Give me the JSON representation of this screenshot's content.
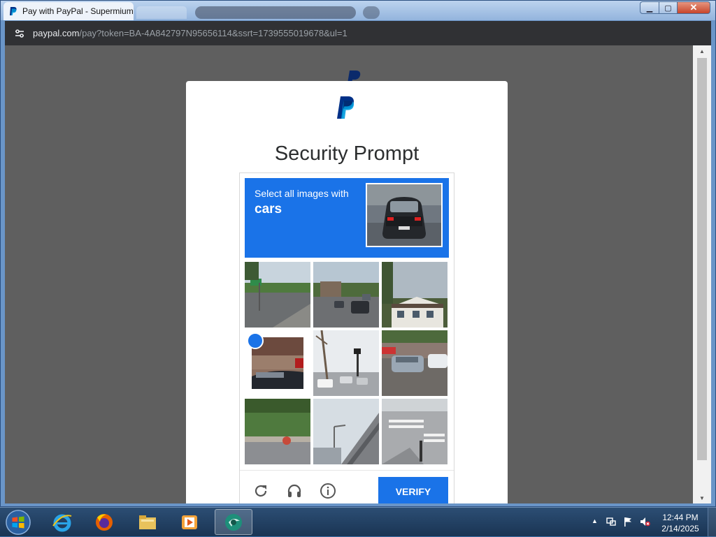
{
  "window": {
    "tab_title": "Pay with PayPal - Supermium",
    "min_glyph": "▁",
    "max_glyph": "▢",
    "close_glyph": "✕"
  },
  "address": {
    "host": "paypal.com",
    "path": "/pay?token=BA-4A842797N95656114&ssrt=1739555019678&ul=1"
  },
  "page": {
    "title": "Security Prompt"
  },
  "captcha": {
    "instruction": "Select all images with",
    "target": "cars",
    "verify_label": "VERIFY",
    "tiles": [
      {
        "id": 1,
        "scene": "road-intersection",
        "selected": false
      },
      {
        "id": 2,
        "scene": "street-cars",
        "selected": false
      },
      {
        "id": 3,
        "scene": "house",
        "selected": false
      },
      {
        "id": 4,
        "scene": "car-closeup",
        "selected": true
      },
      {
        "id": 5,
        "scene": "intersection-traffic-light",
        "selected": false
      },
      {
        "id": 6,
        "scene": "parking-cars",
        "selected": false
      },
      {
        "id": 7,
        "scene": "road-motorbike",
        "selected": false
      },
      {
        "id": 8,
        "scene": "overpass",
        "selected": false
      },
      {
        "id": 9,
        "scene": "crosswalk",
        "selected": false
      }
    ]
  },
  "taskbar": {
    "clock_time": "12:44 PM",
    "clock_date": "2/14/2025"
  },
  "colors": {
    "captcha_blue": "#1a73e8",
    "paypal_dark": "#003087",
    "paypal_light": "#009cde"
  }
}
